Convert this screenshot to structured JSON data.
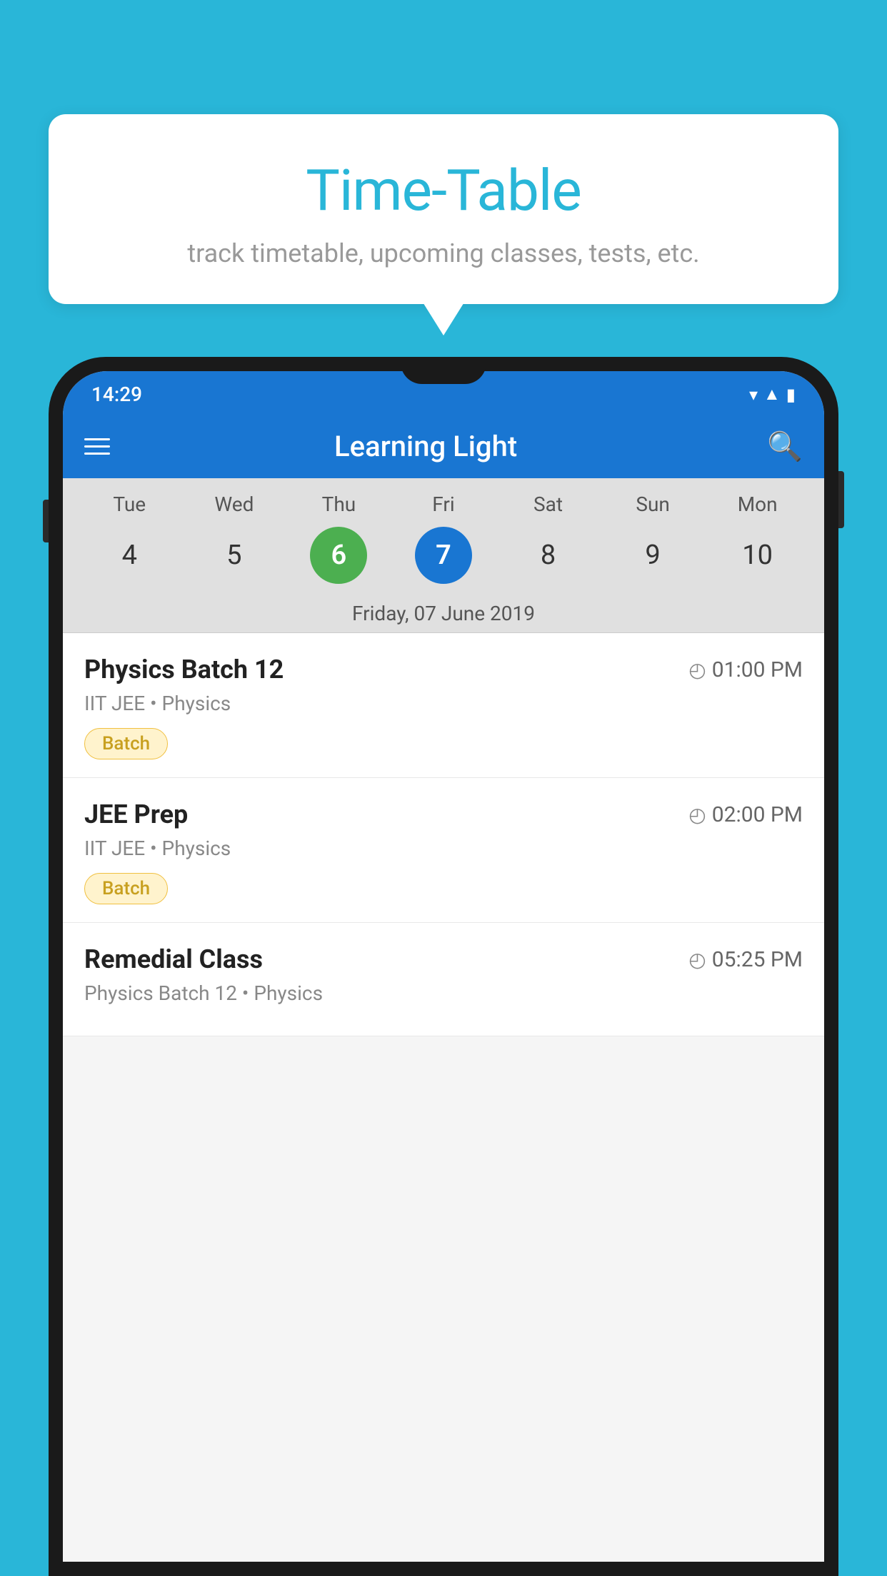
{
  "background_color": "#29b6d8",
  "speech_bubble": {
    "title": "Time-Table",
    "subtitle": "track timetable, upcoming classes, tests, etc."
  },
  "status_bar": {
    "time": "14:29"
  },
  "app_bar": {
    "title": "Learning Light",
    "menu_icon": "menu-icon",
    "search_icon": "search-icon"
  },
  "calendar": {
    "days": [
      "Tue",
      "Wed",
      "Thu",
      "Fri",
      "Sat",
      "Sun",
      "Mon"
    ],
    "dates": [
      "4",
      "5",
      "6",
      "7",
      "8",
      "9",
      "10"
    ],
    "today_index": 2,
    "selected_index": 3,
    "selected_date": "Friday, 07 June 2019"
  },
  "schedule": [
    {
      "title": "Physics Batch 12",
      "time": "01:00 PM",
      "subtitle": "IIT JEE • Physics",
      "badge": "Batch"
    },
    {
      "title": "JEE Prep",
      "time": "02:00 PM",
      "subtitle": "IIT JEE • Physics",
      "badge": "Batch"
    },
    {
      "title": "Remedial Class",
      "time": "05:25 PM",
      "subtitle": "Physics Batch 12 • Physics",
      "badge": null
    }
  ]
}
